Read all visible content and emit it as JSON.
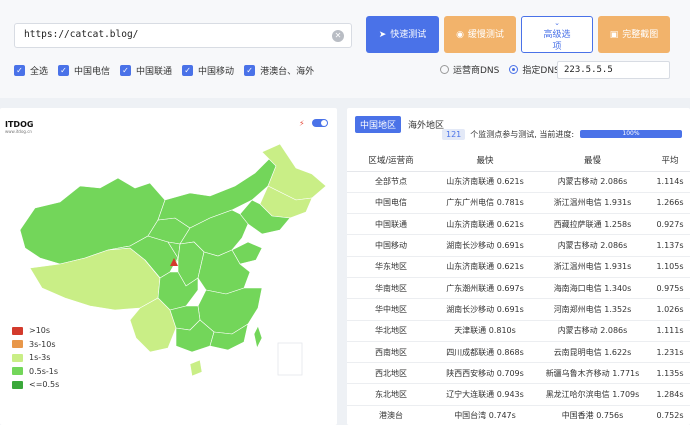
{
  "url": "https://catcat.blog/",
  "buttons": {
    "fast": "快速测试",
    "slow": "缓慢测试",
    "advanced_line1": "高级选",
    "advanced_line2": "项",
    "screenshot": "完整截图"
  },
  "isp_checks": [
    "全选",
    "中国电信",
    "中国联通",
    "中国移动",
    "港澳台、海外"
  ],
  "dns": {
    "option_isp": "运营商DNS",
    "option_custom": "指定DNS:",
    "value": "223.5.5.5"
  },
  "map": {
    "logo_text": "ITDOG",
    "logo_sub": "www.itdog.cn",
    "legend": [
      {
        "label": ">10s",
        "color": "#d33a2c"
      },
      {
        "label": "3s-10s",
        "color": "#e8974a"
      },
      {
        "label": "1s-3s",
        "color": "#c9ee86"
      },
      {
        "label": "0.5s-1s",
        "color": "#73d65a"
      },
      {
        "label": "<=0.5s",
        "color": "#3aa83a"
      }
    ]
  },
  "results": {
    "tab_china": "中国地区",
    "tab_overseas": "海外地区",
    "count": "121",
    "progress_text": "个监测点参与测试, 当前进度:",
    "progress_pct": "100%",
    "headers": [
      "区域/运营商",
      "最快",
      "最慢",
      "平均"
    ],
    "rows": [
      [
        "全部节点",
        "山东济南联通 0.621s",
        "内蒙古移动 2.086s",
        "1.114s"
      ],
      [
        "中国电信",
        "广东广州电信 0.781s",
        "浙江温州电信 1.931s",
        "1.266s"
      ],
      [
        "中国联通",
        "山东济南联通 0.621s",
        "西藏拉萨联通 1.258s",
        "0.927s"
      ],
      [
        "中国移动",
        "湖南长沙移动 0.691s",
        "内蒙古移动 2.086s",
        "1.137s"
      ],
      [
        "华东地区",
        "山东济南联通 0.621s",
        "浙江温州电信 1.931s",
        "1.105s"
      ],
      [
        "华南地区",
        "广东潮州联通 0.697s",
        "海南海口电信 1.340s",
        "0.975s"
      ],
      [
        "华中地区",
        "湖南长沙移动 0.691s",
        "河南郑州电信 1.352s",
        "1.026s"
      ],
      [
        "华北地区",
        "天津联通 0.810s",
        "内蒙古移动 2.086s",
        "1.111s"
      ],
      [
        "西南地区",
        "四川成都联通 0.868s",
        "云南昆明电信 1.622s",
        "1.231s"
      ],
      [
        "西北地区",
        "陕西西安移动 0.709s",
        "新疆乌鲁木齐移动 1.771s",
        "1.135s"
      ],
      [
        "东北地区",
        "辽宁大连联通 0.943s",
        "黑龙江哈尔滨电信 1.709s",
        "1.284s"
      ],
      [
        "港澳台",
        "中国台湾 0.747s",
        "中国香港 0.756s",
        "0.752s"
      ]
    ]
  }
}
